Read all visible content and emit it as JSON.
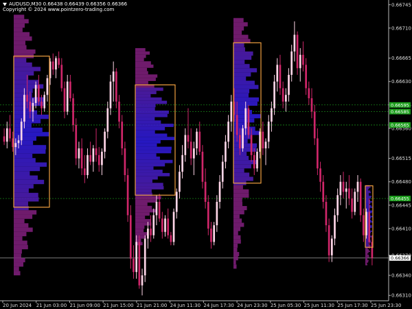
{
  "header": {
    "symbol_line": "AUDUSD,M30  0.66438 0.66439 0.66356 0.66366",
    "copyright": "Copyright © 2024 www.pointzero-trading.com",
    "collapse_icon": "triangle-down-icon"
  },
  "colors": {
    "background": "#000000",
    "bull_candle": "#ffd6e8",
    "bear_candle": "#d0266a",
    "profile_cold": "#2a1bd6",
    "profile_warm": "#7b1e78",
    "value_area_box": "#f0a040",
    "level_green": "#1c9e1c",
    "current_price_line": "#8c8c8c"
  },
  "chart_data": {
    "type": "candlestick",
    "symbol": "AUDUSD",
    "timeframe": "M30",
    "ylim": [
      0.66302,
      0.66752
    ],
    "y_ticks": [
      "0.66745",
      "0.66710",
      "0.66665",
      "0.66630",
      "0.66595",
      "0.66560",
      "0.66515",
      "0.66480",
      "0.66445",
      "0.66410",
      "0.66370",
      "0.66340",
      "0.66310"
    ],
    "y_tick_values": [
      0.66745,
      0.6671,
      0.66665,
      0.6663,
      0.66595,
      0.6656,
      0.66515,
      0.6648,
      0.66445,
      0.6641,
      0.6637,
      0.6634,
      0.6631
    ],
    "x_ticks": [
      "20 Jun 2024",
      "21 Jun 03:00",
      "21 Jun 09:00",
      "21 Jun 15:00",
      "21 Jun 21:00",
      "24 Jun 11:30",
      "24 Jun 17:30",
      "24 Jun 23:30",
      "25 Jun 05:30",
      "25 Jun 11:30",
      "25 Jun 17:30",
      "25 Jun 23:30"
    ],
    "levels": {
      "green_tags": [
        {
          "label": "0.66595",
          "value": 0.66595
        },
        {
          "label": "0.66585",
          "value": 0.66585
        },
        {
          "label": "0.66565",
          "value": 0.66565
        },
        {
          "label": "0.66455",
          "value": 0.66455
        }
      ],
      "current_price": {
        "label": "0.66366",
        "value": 0.66366
      }
    },
    "candles_ohlc": [
      [
        0.66548,
        0.6656,
        0.66535,
        0.6654
      ],
      [
        0.6654,
        0.6657,
        0.6653,
        0.6656
      ],
      [
        0.6656,
        0.6658,
        0.6654,
        0.66545
      ],
      [
        0.66545,
        0.66555,
        0.66525,
        0.66532
      ],
      [
        0.66532,
        0.66545,
        0.6652,
        0.66538
      ],
      [
        0.66538,
        0.6655,
        0.6653,
        0.66542
      ],
      [
        0.66542,
        0.66575,
        0.66535,
        0.6657
      ],
      [
        0.6657,
        0.6662,
        0.6656,
        0.6661
      ],
      [
        0.6661,
        0.6664,
        0.6659,
        0.666
      ],
      [
        0.666,
        0.66615,
        0.66575,
        0.66585
      ],
      [
        0.66585,
        0.66605,
        0.6657,
        0.66598
      ],
      [
        0.66598,
        0.6663,
        0.6659,
        0.66625
      ],
      [
        0.66625,
        0.6664,
        0.66595,
        0.666
      ],
      [
        0.666,
        0.6661,
        0.6658,
        0.6659
      ],
      [
        0.6659,
        0.66615,
        0.66585,
        0.6661
      ],
      [
        0.6661,
        0.6664,
        0.666,
        0.66635
      ],
      [
        0.66635,
        0.66665,
        0.66625,
        0.6666
      ],
      [
        0.6666,
        0.66672,
        0.6664,
        0.66648
      ],
      [
        0.66648,
        0.66668,
        0.66635,
        0.66665
      ],
      [
        0.66665,
        0.66675,
        0.6665,
        0.66655
      ],
      [
        0.66655,
        0.66665,
        0.66615,
        0.6662
      ],
      [
        0.6662,
        0.6663,
        0.66575,
        0.66585
      ],
      [
        0.66585,
        0.6664,
        0.6658,
        0.6663
      ],
      [
        0.6663,
        0.6664,
        0.666,
        0.66605
      ],
      [
        0.66605,
        0.66612,
        0.66555,
        0.66565
      ],
      [
        0.66565,
        0.66575,
        0.66505,
        0.66515
      ],
      [
        0.66515,
        0.6654,
        0.665,
        0.6653
      ],
      [
        0.6653,
        0.66545,
        0.6649,
        0.665
      ],
      [
        0.665,
        0.6652,
        0.66478,
        0.6649
      ],
      [
        0.6649,
        0.6653,
        0.66485,
        0.6652
      ],
      [
        0.6652,
        0.6654,
        0.66505,
        0.6651
      ],
      [
        0.6651,
        0.66535,
        0.66495,
        0.6653
      ],
      [
        0.6653,
        0.6656,
        0.6651,
        0.6652
      ],
      [
        0.6652,
        0.66532,
        0.66495,
        0.66505
      ],
      [
        0.66505,
        0.6653,
        0.6649,
        0.66525
      ],
      [
        0.66525,
        0.6656,
        0.66515,
        0.66555
      ],
      [
        0.66555,
        0.666,
        0.66545,
        0.6659
      ],
      [
        0.6659,
        0.6664,
        0.6658,
        0.6663
      ],
      [
        0.6663,
        0.6666,
        0.666,
        0.66645
      ],
      [
        0.66645,
        0.6665,
        0.6659,
        0.666
      ],
      [
        0.666,
        0.6661,
        0.6656,
        0.6657
      ],
      [
        0.6657,
        0.6658,
        0.6652,
        0.6653
      ],
      [
        0.6653,
        0.6654,
        0.6648,
        0.6649
      ],
      [
        0.6649,
        0.665,
        0.6642,
        0.6643
      ],
      [
        0.6643,
        0.66445,
        0.6635,
        0.66365
      ],
      [
        0.66365,
        0.66385,
        0.66335,
        0.66345
      ],
      [
        0.66345,
        0.664,
        0.66335,
        0.6639
      ],
      [
        0.6639,
        0.664,
        0.6632,
        0.66325
      ],
      [
        0.66325,
        0.6635,
        0.6631,
        0.6634
      ],
      [
        0.6634,
        0.664,
        0.6633,
        0.66395
      ],
      [
        0.66395,
        0.6642,
        0.6638,
        0.6641
      ],
      [
        0.6641,
        0.6643,
        0.6639,
        0.664
      ],
      [
        0.664,
        0.6644,
        0.66395,
        0.6643
      ],
      [
        0.6643,
        0.6646,
        0.66415,
        0.6645
      ],
      [
        0.6645,
        0.66462,
        0.6642,
        0.66425
      ],
      [
        0.66425,
        0.66435,
        0.66395,
        0.66405
      ],
      [
        0.66405,
        0.6643,
        0.66398,
        0.66425
      ],
      [
        0.66425,
        0.6644,
        0.66395,
        0.664
      ],
      [
        0.664,
        0.66405,
        0.66385,
        0.6639
      ],
      [
        0.6639,
        0.6644,
        0.66385,
        0.66435
      ],
      [
        0.66435,
        0.6647,
        0.66425,
        0.66465
      ],
      [
        0.66465,
        0.66505,
        0.66455,
        0.66495
      ],
      [
        0.66495,
        0.66535,
        0.66485,
        0.6652
      ],
      [
        0.6652,
        0.6656,
        0.6651,
        0.6655
      ],
      [
        0.6655,
        0.6659,
        0.6653,
        0.6654
      ],
      [
        0.6654,
        0.6656,
        0.66505,
        0.66515
      ],
      [
        0.66515,
        0.6654,
        0.6649,
        0.6653
      ],
      [
        0.6653,
        0.6656,
        0.6652,
        0.66555
      ],
      [
        0.66555,
        0.6657,
        0.6652,
        0.66525
      ],
      [
        0.66525,
        0.66535,
        0.6647,
        0.6648
      ],
      [
        0.6648,
        0.665,
        0.6644,
        0.6645
      ],
      [
        0.6645,
        0.6646,
        0.664,
        0.6641
      ],
      [
        0.6641,
        0.6642,
        0.6638,
        0.6639
      ],
      [
        0.6639,
        0.6642,
        0.66385,
        0.66415
      ],
      [
        0.66415,
        0.6646,
        0.66405,
        0.6645
      ],
      [
        0.6645,
        0.6649,
        0.6644,
        0.6648
      ],
      [
        0.6648,
        0.6652,
        0.6647,
        0.6651
      ],
      [
        0.6651,
        0.6655,
        0.665,
        0.6654
      ],
      [
        0.6654,
        0.6658,
        0.6653,
        0.6657
      ],
      [
        0.6657,
        0.6661,
        0.66555,
        0.666
      ],
      [
        0.666,
        0.6662,
        0.6657,
        0.6658
      ],
      [
        0.6658,
        0.666,
        0.6654,
        0.6655
      ],
      [
        0.6655,
        0.6656,
        0.6652,
        0.6653
      ],
      [
        0.6653,
        0.66565,
        0.66525,
        0.6656
      ],
      [
        0.6656,
        0.666,
        0.6655,
        0.6659
      ],
      [
        0.6659,
        0.66595,
        0.66545,
        0.6655
      ],
      [
        0.6655,
        0.6656,
        0.6651,
        0.6652
      ],
      [
        0.6652,
        0.6653,
        0.6649,
        0.665
      ],
      [
        0.665,
        0.6653,
        0.66495,
        0.66525
      ],
      [
        0.66525,
        0.6656,
        0.66515,
        0.66555
      ],
      [
        0.66555,
        0.6657,
        0.6652,
        0.6653
      ],
      [
        0.6653,
        0.66545,
        0.66505,
        0.6654
      ],
      [
        0.6654,
        0.6658,
        0.6653,
        0.6657
      ],
      [
        0.6657,
        0.666,
        0.66555,
        0.6659
      ],
      [
        0.6659,
        0.6664,
        0.6658,
        0.6663
      ],
      [
        0.6663,
        0.66665,
        0.66615,
        0.66655
      ],
      [
        0.66655,
        0.6667,
        0.6661,
        0.6662
      ],
      [
        0.6662,
        0.6663,
        0.6659,
        0.666
      ],
      [
        0.666,
        0.6662,
        0.66585,
        0.6661
      ],
      [
        0.6661,
        0.6665,
        0.666,
        0.6664
      ],
      [
        0.6664,
        0.66685,
        0.6663,
        0.66675
      ],
      [
        0.66675,
        0.6672,
        0.6666,
        0.667
      ],
      [
        0.667,
        0.66705,
        0.6664,
        0.6665
      ],
      [
        0.6665,
        0.6668,
        0.6663,
        0.6667
      ],
      [
        0.6667,
        0.6669,
        0.66645,
        0.66655
      ],
      [
        0.66655,
        0.66665,
        0.6661,
        0.6662
      ],
      [
        0.6662,
        0.6663,
        0.66595,
        0.66605
      ],
      [
        0.66605,
        0.6662,
        0.66575,
        0.66585
      ],
      [
        0.66585,
        0.66595,
        0.66535,
        0.66545
      ],
      [
        0.66545,
        0.6656,
        0.6649,
        0.665
      ],
      [
        0.665,
        0.6651,
        0.66465,
        0.6648
      ],
      [
        0.6648,
        0.6649,
        0.6644,
        0.6645
      ],
      [
        0.6645,
        0.6646,
        0.66405,
        0.66415
      ],
      [
        0.66415,
        0.66425,
        0.6636,
        0.6637
      ],
      [
        0.6637,
        0.664,
        0.6636,
        0.66395
      ],
      [
        0.66395,
        0.6644,
        0.66385,
        0.6643
      ],
      [
        0.6643,
        0.6647,
        0.6642,
        0.6646
      ],
      [
        0.6646,
        0.6649,
        0.66445,
        0.6648
      ],
      [
        0.6648,
        0.66495,
        0.66455,
        0.66465
      ],
      [
        0.66465,
        0.6648,
        0.6644,
        0.6647
      ],
      [
        0.6647,
        0.6649,
        0.66445,
        0.66455
      ],
      [
        0.66455,
        0.6647,
        0.66425,
        0.66435
      ],
      [
        0.66435,
        0.6647,
        0.6643,
        0.66465
      ],
      [
        0.66465,
        0.6649,
        0.6645,
        0.6648
      ],
      [
        0.6648,
        0.66485,
        0.6642,
        0.6643
      ],
      [
        0.6643,
        0.6644,
        0.6639,
        0.664
      ],
      [
        0.664,
        0.6644,
        0.66395,
        0.66435
      ],
      [
        0.66435,
        0.66455,
        0.6638,
        0.6639
      ],
      [
        0.6639,
        0.664,
        0.66355,
        0.66366
      ]
    ],
    "volume_profiles": [
      {
        "session": 1,
        "price_top": 0.6673,
        "price_bottom": 0.6634,
        "value_area_high": 0.66668,
        "value_area_low": 0.66442
      },
      {
        "session": 2,
        "price_top": 0.6668,
        "price_bottom": 0.66385,
        "value_area_high": 0.66625,
        "value_area_low": 0.6646
      },
      {
        "session": 3,
        "price_top": 0.66725,
        "price_bottom": 0.6635,
        "value_area_high": 0.66688,
        "value_area_low": 0.66478
      },
      {
        "session": 4,
        "price_top": 0.66475,
        "price_bottom": 0.66355,
        "value_area_high": 0.66474,
        "value_area_low": 0.66382
      }
    ]
  }
}
